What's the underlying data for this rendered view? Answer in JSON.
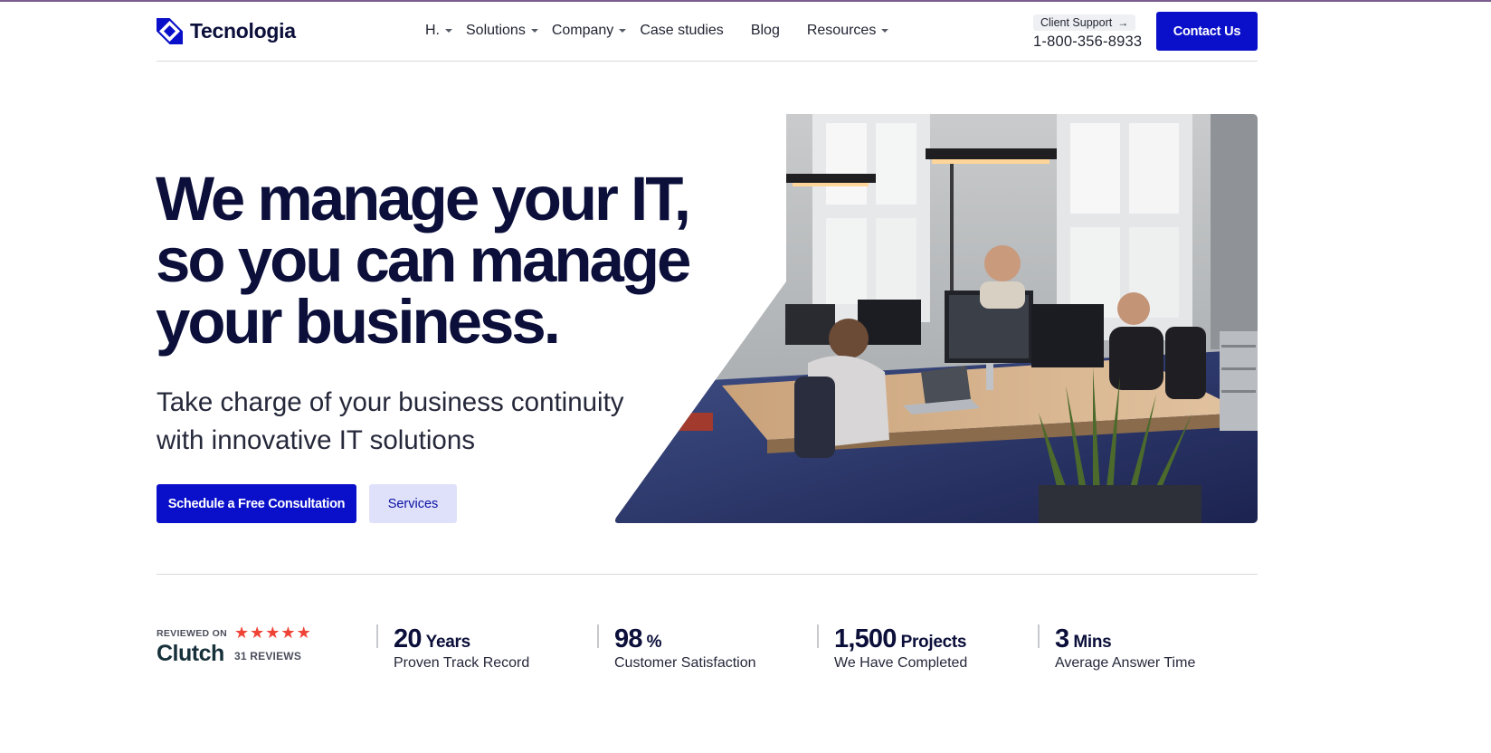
{
  "brand": {
    "name": "Tecnologia",
    "accent": "#0a10c9",
    "dark": "#0b0f3a"
  },
  "nav": {
    "items": [
      {
        "label": "H.",
        "dropdown": true
      },
      {
        "label": "Solutions",
        "dropdown": true
      },
      {
        "label": "Company",
        "dropdown": true
      },
      {
        "label": "Case studies",
        "dropdown": false
      },
      {
        "label": "Blog",
        "dropdown": false
      },
      {
        "label": "Resources",
        "dropdown": true
      }
    ]
  },
  "support": {
    "label": "Client Support",
    "arrow_icon": "arrow-right-icon",
    "phone": "1-800-356-8933"
  },
  "contact_button": "Contact Us",
  "hero": {
    "title_lines": [
      "We manage your IT,",
      "so you can manage",
      "your business."
    ],
    "subtitle_lines": [
      "Take charge of your business continuity",
      "with innovative IT solutions"
    ],
    "primary_button": "Schedule a Free Consultation",
    "secondary_button": "Services"
  },
  "clutch": {
    "reviewed_on": "REVIEWED ON",
    "logo_text": "Clutch",
    "rating_stars": 5,
    "reviews": "31 REVIEWS",
    "star_color": "#ef4336"
  },
  "stats": [
    {
      "number": "20",
      "unit": "Years",
      "label": "Proven Track Record"
    },
    {
      "number": "98",
      "unit": "%",
      "label": "Customer Satisfaction"
    },
    {
      "number": "1,500",
      "unit": "Projects",
      "label": "We Have Completed"
    },
    {
      "number": "3",
      "unit": "Mins",
      "label": "Average Answer Time"
    }
  ]
}
